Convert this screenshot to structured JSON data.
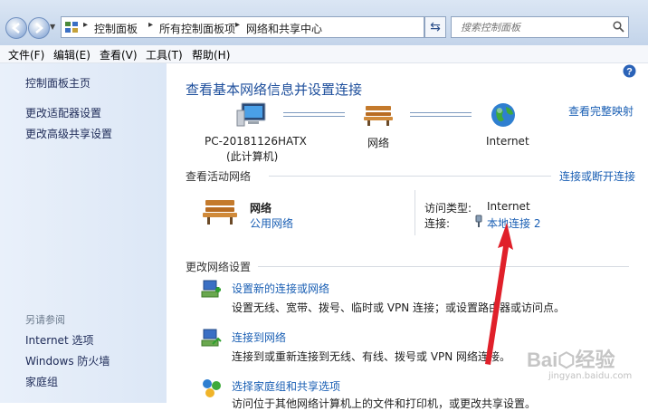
{
  "breadcrumb": {
    "items": [
      "控制面板",
      "所有控制面板项",
      "网络和共享中心"
    ]
  },
  "search": {
    "placeholder": "搜索控制面板"
  },
  "menu": [
    "文件(F)",
    "编辑(E)",
    "查看(V)",
    "工具(T)",
    "帮助(H)"
  ],
  "sidebar": {
    "home": "控制面板主页",
    "links": [
      "更改适配器设置",
      "更改高级共享设置"
    ],
    "see_also_title": "另请参阅",
    "see_also": [
      "Internet 选项",
      "Windows 防火墙",
      "家庭组"
    ]
  },
  "main": {
    "title": "查看基本网络信息并设置连接",
    "full_map": "查看完整映射",
    "map": {
      "pc_name": "PC-20181126HATX",
      "pc_sub": "(此计算机)",
      "network": "网络",
      "internet": "Internet"
    },
    "active_title": "查看活动网络",
    "connect_link": "连接或断开连接",
    "active": {
      "name": "网络",
      "type": "公用网络",
      "access_label": "访问类型:",
      "access_value": "Internet",
      "conn_label": "连接:",
      "conn_value": "本地连接 2"
    },
    "change_title": "更改网络设置",
    "tasks": [
      {
        "title": "设置新的连接或网络",
        "desc": "设置无线、宽带、拨号、临时或 VPN 连接；或设置路由器或访问点。"
      },
      {
        "title": "连接到网络",
        "desc": "连接到或重新连接到无线、有线、拨号或 VPN 网络连接。"
      },
      {
        "title": "选择家庭组和共享选项",
        "desc": "访问位于其他网络计算机上的文件和打印机，或更改共享设置。"
      }
    ]
  },
  "colors": {
    "accent": "#1a5fb4",
    "arrow": "#e0202a"
  }
}
